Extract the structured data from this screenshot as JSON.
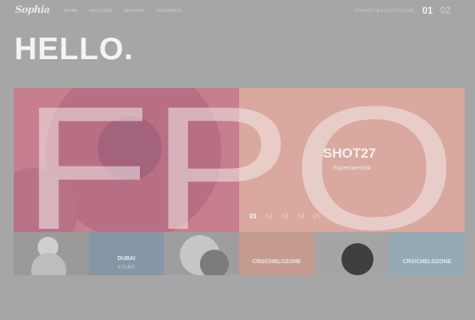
{
  "header": {
    "logo": "Sophia",
    "nav": [
      "WORK",
      "HOUTURE",
      "ARCHIVE",
      "FEEDBACK"
    ],
    "email": "CONTACT@SCOOTLY.COM",
    "pages": [
      "01",
      "02"
    ],
    "active_page": "01"
  },
  "hero": {
    "title": "HELLO."
  },
  "featured": {
    "title": "SHOT27",
    "subtitle": "Experimental",
    "slides": [
      "01",
      "02",
      "03",
      "04",
      "05"
    ],
    "active_slide": "01"
  },
  "thumbnails": [
    {
      "label": "",
      "sublabel": ""
    },
    {
      "label": "DUBAI",
      "sublabel": "STARS"
    },
    {
      "label": "",
      "sublabel": ""
    },
    {
      "label": "CRS/CHELOZONE",
      "sublabel": ""
    },
    {
      "label": "",
      "sublabel": ""
    },
    {
      "label": "CRS/CHELOZONE",
      "sublabel": ""
    }
  ],
  "placeholder": {
    "text": "FPO"
  },
  "colors": {
    "page_background": "#a6a6a6",
    "left_panel": "#c77e8e",
    "right_panel": "#d9a89f",
    "overlay_text": "#f2e9ea"
  }
}
